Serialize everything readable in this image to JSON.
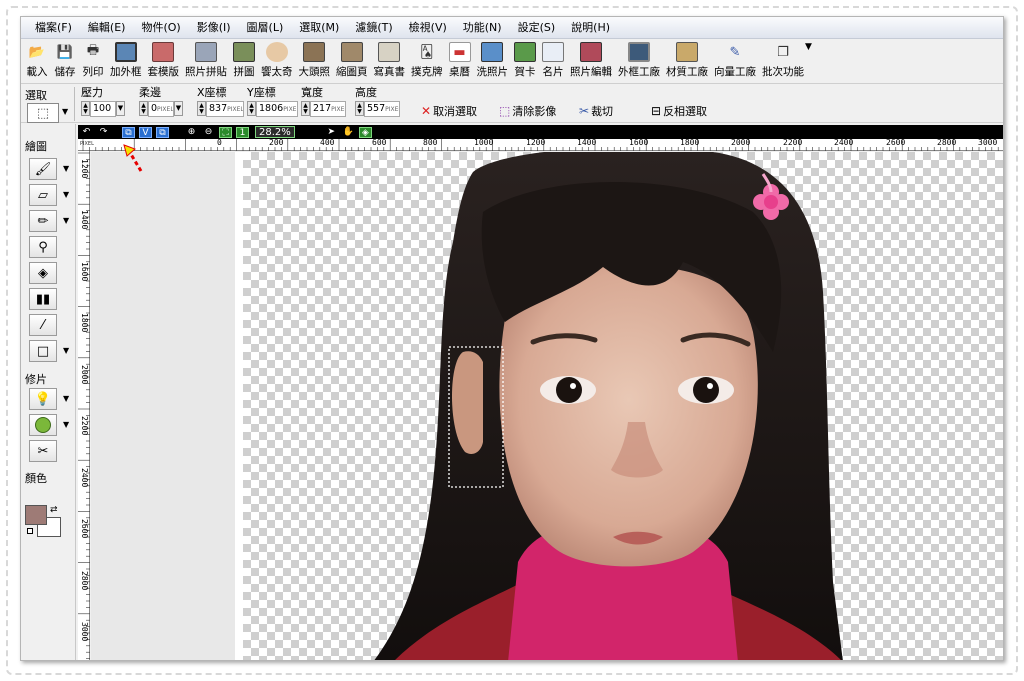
{
  "menu": [
    "檔案(F)",
    "編輯(E)",
    "物件(O)",
    "影像(I)",
    "圖層(L)",
    "選取(M)",
    "濾鏡(T)",
    "檢視(V)",
    "功能(N)",
    "設定(S)",
    "說明(H)"
  ],
  "toolbar": [
    {
      "label": "載入",
      "icon": "folder-open-icon"
    },
    {
      "label": "儲存",
      "icon": "save-icon"
    },
    {
      "label": "列印",
      "icon": "print-icon"
    },
    {
      "label": "加外框",
      "icon": "frame-icon"
    },
    {
      "label": "套模版",
      "icon": "template-icon"
    },
    {
      "label": "照片拼貼",
      "icon": "collage-icon"
    },
    {
      "label": "拼圖",
      "icon": "puzzle-icon"
    },
    {
      "label": "饗太奇",
      "icon": "avatar-icon"
    },
    {
      "label": "大頭照",
      "icon": "id-photo-icon"
    },
    {
      "label": "縮圖頁",
      "icon": "thumbnails-icon"
    },
    {
      "label": "寫真書",
      "icon": "photobook-icon"
    },
    {
      "label": "撲克牌",
      "icon": "cards-icon"
    },
    {
      "label": "桌曆",
      "icon": "calendar-icon"
    },
    {
      "label": "洗照片",
      "icon": "print-photo-icon"
    },
    {
      "label": "賀卡",
      "icon": "greeting-card-icon"
    },
    {
      "label": "名片",
      "icon": "business-card-icon"
    },
    {
      "label": "照片編輯",
      "icon": "photo-edit-icon"
    },
    {
      "label": "外框工廠",
      "icon": "frame-factory-icon"
    },
    {
      "label": "材質工廠",
      "icon": "texture-factory-icon"
    },
    {
      "label": "向量工廠",
      "icon": "vector-factory-icon"
    },
    {
      "label": "批次功能",
      "icon": "batch-icon"
    }
  ],
  "options": {
    "select_label": "選取",
    "pressure": {
      "label": "壓力",
      "value": "100"
    },
    "feather": {
      "label": "柔邊",
      "value": "0"
    },
    "x": {
      "label": "X座標",
      "value": "837"
    },
    "y": {
      "label": "Y座標",
      "value": "1806"
    },
    "width": {
      "label": "寬度",
      "value": "217"
    },
    "height": {
      "label": "高度",
      "value": "557"
    },
    "unit": "PIXEL",
    "cancel_select": "取消選取",
    "clear_image": "清除影像",
    "crop": "裁切",
    "invert_select": "反相選取"
  },
  "left_panel": {
    "draw_label": "繪圖",
    "retouch_label": "修片",
    "color_label": "顏色",
    "fg_color": "#9e7b76",
    "bg_color": "#ffffff"
  },
  "canvas": {
    "zoom": "28.2%",
    "ruler_unit": "PIXEL",
    "h_ticks": [
      "0",
      "200",
      "400",
      "600",
      "800",
      "1000",
      "1200",
      "1400",
      "1600",
      "1800",
      "2000",
      "2200",
      "2400",
      "2600",
      "2800",
      "3000"
    ],
    "v_ticks": [
      "1200",
      "1400",
      "1600",
      "1800",
      "2000",
      "2200",
      "2400",
      "2600",
      "2800",
      "3000"
    ]
  }
}
